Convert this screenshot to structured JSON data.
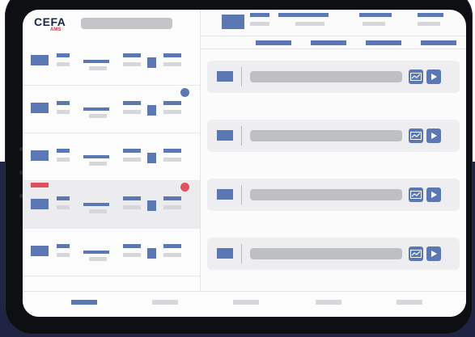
{
  "app": {
    "logo_text": "CEFA",
    "logo_sub": "AMS"
  },
  "colors": {
    "accent": "#5b78b4",
    "placeholder": "#d6d7da",
    "notification_blue": "#5b78b4",
    "notification_red": "#e0515f",
    "background_navy": "#1f2444"
  },
  "icons": {
    "chart": "trend-chart-icon",
    "play": "play-icon"
  },
  "tabs": {
    "active_index": 0,
    "count": 5
  }
}
